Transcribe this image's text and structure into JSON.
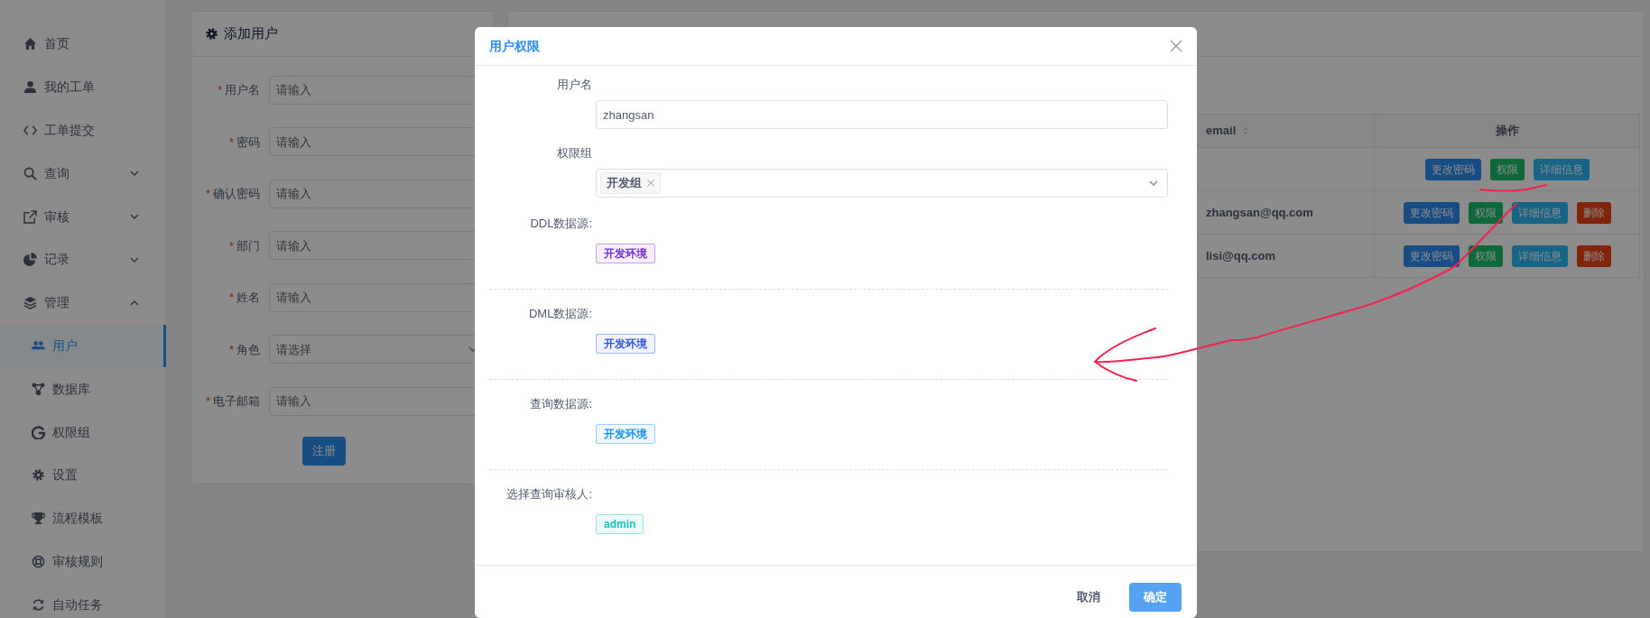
{
  "sidebar": {
    "items": [
      {
        "label": "首页",
        "selected": false
      },
      {
        "label": "我的工单",
        "selected": false
      },
      {
        "label": "工单提交",
        "selected": false
      },
      {
        "label": "查询",
        "selected": false,
        "expanded": false
      },
      {
        "label": "审核",
        "selected": false,
        "expanded": false
      },
      {
        "label": "记录",
        "selected": false,
        "expanded": false
      },
      {
        "label": "管理",
        "selected": false,
        "expanded": true,
        "children": [
          {
            "label": "用户",
            "selected": true
          },
          {
            "label": "数据库",
            "selected": false
          },
          {
            "label": "权限组",
            "selected": false
          },
          {
            "label": "设置",
            "selected": false
          },
          {
            "label": "流程模板",
            "selected": false
          },
          {
            "label": "审核规则",
            "selected": false
          },
          {
            "label": "自动任务",
            "selected": false
          }
        ]
      }
    ]
  },
  "add_user": {
    "title": "添加用户",
    "fields": [
      {
        "mark": "*",
        "label": "用户名",
        "kind": "input",
        "placeholder": "请输入"
      },
      {
        "mark": "*",
        "label": "密码",
        "kind": "input",
        "placeholder": "请输入"
      },
      {
        "mark": "*",
        "label": "确认密码",
        "kind": "input",
        "placeholder": "请输入"
      },
      {
        "mark": "*",
        "label": "部门",
        "kind": "input",
        "placeholder": "请输入"
      },
      {
        "mark": "*",
        "label": "姓名",
        "kind": "input",
        "placeholder": "请输入"
      },
      {
        "mark": "*",
        "label": "角色",
        "kind": "select",
        "placeholder": "请选择"
      },
      {
        "mark": "*",
        "label": "电子邮箱",
        "kind": "input",
        "placeholder": "请输入"
      }
    ],
    "submit": "注册"
  },
  "table": {
    "columns": [
      {
        "label": "email",
        "sortable": true
      },
      {
        "label": "操作",
        "sortable": false
      }
    ],
    "rows": [
      {
        "actions": [
          {
            "label": "更改密码",
            "kind": "primary"
          },
          {
            "label": "权限",
            "kind": "success"
          },
          {
            "label": "详细信息",
            "kind": "info"
          }
        ]
      },
      {
        "email": "zhangsan@qq.com",
        "actions": [
          {
            "label": "更改密码",
            "kind": "primary"
          },
          {
            "label": "权限",
            "kind": "success"
          },
          {
            "label": "详细信息",
            "kind": "info"
          },
          {
            "label": "删除",
            "kind": "danger"
          }
        ]
      },
      {
        "email": "lisi@qq.com",
        "actions": [
          {
            "label": "更改密码",
            "kind": "primary"
          },
          {
            "label": "权限",
            "kind": "success"
          },
          {
            "label": "详细信息",
            "kind": "info"
          },
          {
            "label": "删除",
            "kind": "danger"
          }
        ]
      }
    ]
  },
  "modal": {
    "title": "用户权限",
    "username": {
      "label": "用户名",
      "value": "zhangsan"
    },
    "group": {
      "label": "权限组",
      "tags": [
        {
          "label": "开发组"
        }
      ]
    },
    "sections": [
      {
        "label": "DDL数据源:",
        "tags": [
          {
            "label": "开发环境",
            "color": "#722ed1"
          }
        ]
      },
      {
        "label": "DML数据源:",
        "tags": [
          {
            "label": "开发环境",
            "color": "#2f54eb"
          }
        ]
      },
      {
        "label": "查询数据源:",
        "tags": [
          {
            "label": "开发环境",
            "color": "#1890ff"
          }
        ]
      },
      {
        "label": "选择查询审核人:",
        "tags": [
          {
            "label": "admin",
            "color": "#13c2c2"
          }
        ]
      }
    ],
    "buttons": [
      {
        "label": "取消",
        "kind": "default"
      },
      {
        "label": "确定",
        "kind": "primary"
      }
    ]
  }
}
